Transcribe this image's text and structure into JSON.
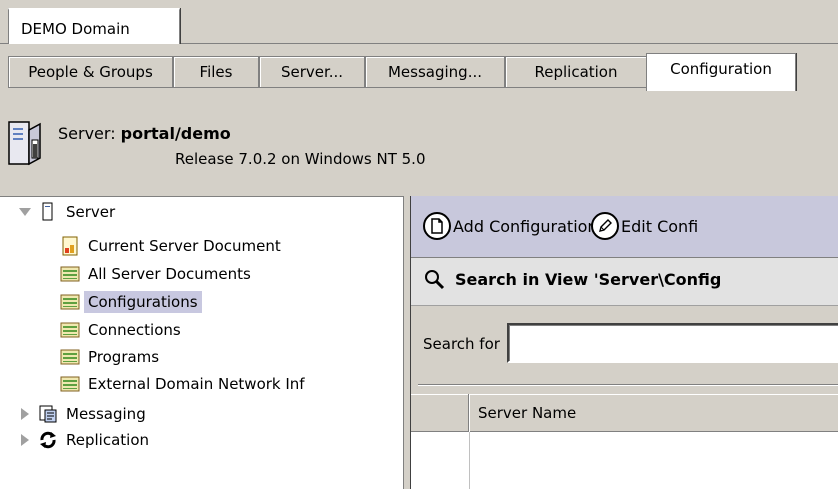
{
  "domain_tab": {
    "label": "DEMO Domain"
  },
  "tabs": [
    {
      "label": "People & Groups",
      "active": false
    },
    {
      "label": "Files",
      "active": false
    },
    {
      "label": "Server...",
      "active": false
    },
    {
      "label": "Messaging...",
      "active": false
    },
    {
      "label": "Replication",
      "active": false
    },
    {
      "label": "Configuration",
      "active": true
    }
  ],
  "server": {
    "prefix": "Server: ",
    "name": "portal/demo",
    "release": "Release 7.0.2 on Windows NT 5.0"
  },
  "tree": {
    "root": {
      "label": "Server",
      "icon": "server-icon",
      "expanded": true
    },
    "children": [
      {
        "label": "Current Server Document",
        "icon": "document-icon",
        "selected": false
      },
      {
        "label": "All Server Documents",
        "icon": "view-icon",
        "selected": false
      },
      {
        "label": "Configurations",
        "icon": "view-icon",
        "selected": true
      },
      {
        "label": "Connections",
        "icon": "view-icon",
        "selected": false
      },
      {
        "label": "Programs",
        "icon": "view-icon",
        "selected": false
      },
      {
        "label": "External Domain Network Inf",
        "icon": "view-icon",
        "selected": false
      }
    ],
    "siblings": [
      {
        "label": "Messaging",
        "icon": "messaging-icon",
        "expanded": false
      },
      {
        "label": "Replication",
        "icon": "replication-icon",
        "expanded": false
      }
    ]
  },
  "actions": {
    "add": "Add Configuration",
    "edit": "Edit Confi"
  },
  "search": {
    "title": "Search in View 'Server\\Config",
    "label": "Search for",
    "value": ""
  },
  "view": {
    "columns": [
      "Server Name"
    ]
  },
  "colors": {
    "chrome": "#d4d0c8",
    "selection": "#c8c8e0",
    "action_bar": "#c8c8dc"
  }
}
